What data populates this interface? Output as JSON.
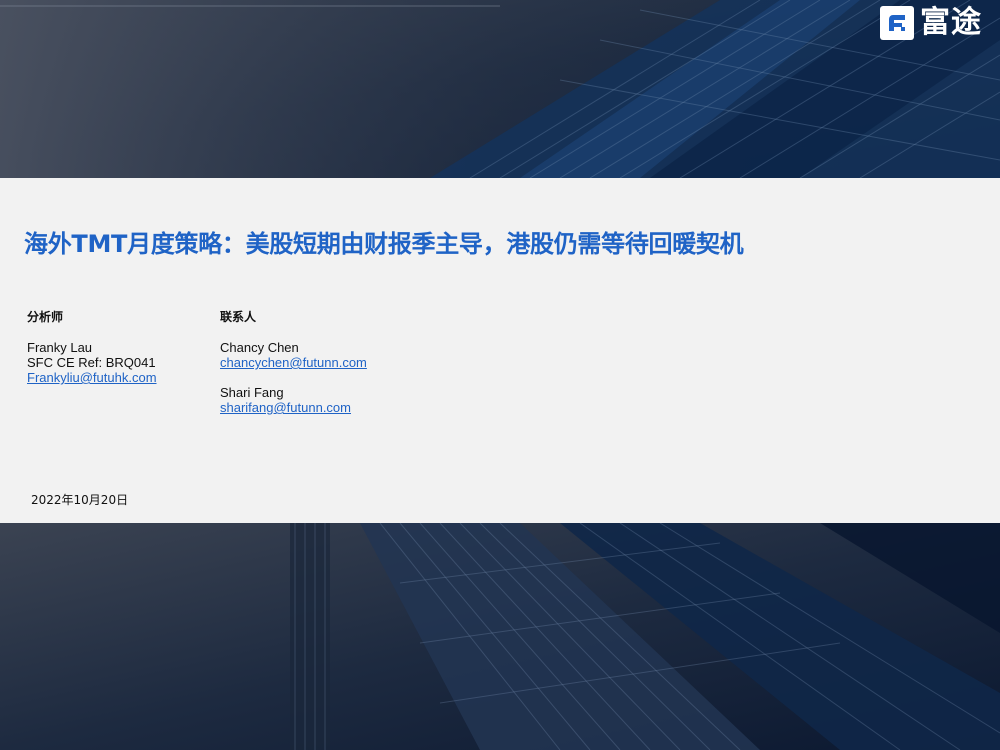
{
  "brand": {
    "name": "富途",
    "colors": {
      "primary_blue": "#1f63c6",
      "band_gray": "#f2f2f2",
      "dark_navy": "#0f1a2c"
    }
  },
  "report": {
    "title": "海外TMT月度策略：美股短期由财报季主导，港股仍需等待回暖契机",
    "date": "2022年10月20日"
  },
  "analyst": {
    "heading": "分析师",
    "name": "Franky Lau",
    "ref": "SFC CE Ref: BRQ041",
    "email": "Frankyliu@futuhk.com"
  },
  "contacts": {
    "heading": "联系人",
    "people": [
      {
        "name": "Chancy Chen",
        "email": "chancychen@futunn.com"
      },
      {
        "name": "Shari Fang",
        "email": "sharifang@futunn.com"
      }
    ]
  },
  "images": {
    "top": "building-glass-facade-photo",
    "bottom": "building-glass-facade-photo"
  }
}
